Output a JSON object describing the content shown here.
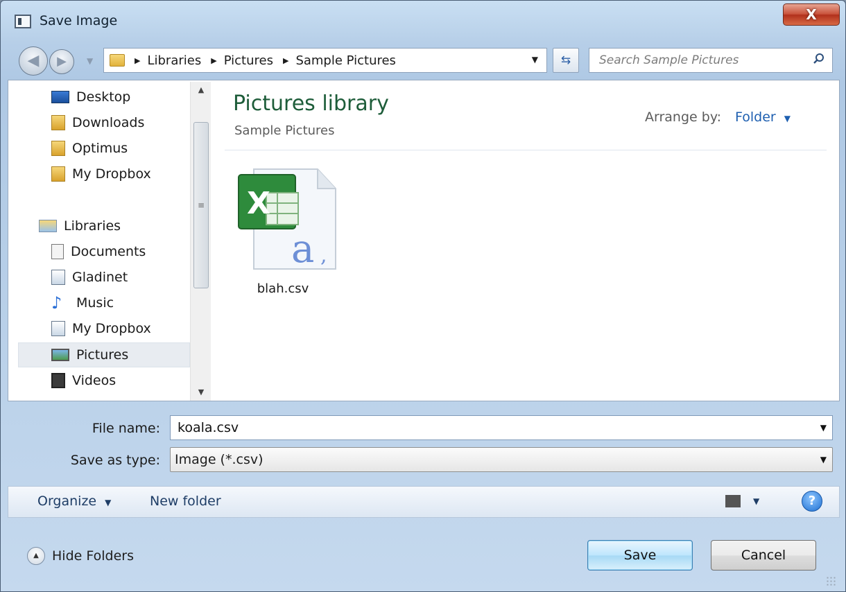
{
  "window": {
    "title": "Save Image",
    "close_label": "X"
  },
  "address": {
    "crumbs": [
      "Libraries",
      "Pictures",
      "Sample Pictures"
    ],
    "search_placeholder": "Search Sample Pictures"
  },
  "nav_pane": {
    "items": [
      {
        "label": "Desktop",
        "icon": "desktop-icon"
      },
      {
        "label": "Downloads",
        "icon": "downloads-folder-icon"
      },
      {
        "label": "Optimus",
        "icon": "user-folder-icon"
      },
      {
        "label": "My Dropbox",
        "icon": "dropbox-folder-icon"
      },
      {
        "label": "Libraries",
        "icon": "libraries-icon"
      },
      {
        "label": "Documents",
        "icon": "documents-icon"
      },
      {
        "label": "Gladinet",
        "icon": "gladinet-icon"
      },
      {
        "label": "Music",
        "icon": "music-icon"
      },
      {
        "label": "My Dropbox",
        "icon": "dropbox-library-icon"
      },
      {
        "label": "Pictures",
        "icon": "pictures-icon"
      },
      {
        "label": "Videos",
        "icon": "videos-icon"
      }
    ],
    "selected": "Pictures"
  },
  "file_pane": {
    "library_title": "Pictures library",
    "library_subtitle": "Sample Pictures",
    "arrange_label": "Arrange by:",
    "arrange_value": "Folder",
    "files": [
      {
        "name": "blah.csv",
        "icon": "excel-csv-file-icon"
      }
    ]
  },
  "form": {
    "file_name_label": "File name:",
    "file_name_value": "koala.csv",
    "save_type_label": "Save as type:",
    "save_type_value": "Image (*.csv)"
  },
  "toolbar": {
    "organize": "Organize",
    "new_folder": "New folder",
    "help": "?"
  },
  "footer": {
    "hide_folders": "Hide Folders",
    "save": "Save",
    "cancel": "Cancel"
  },
  "colors": {
    "library_title": "#1e5d3a",
    "link_blue": "#1e5fb0",
    "close_red": "#c9523b",
    "save_button": "#bee6fd"
  }
}
